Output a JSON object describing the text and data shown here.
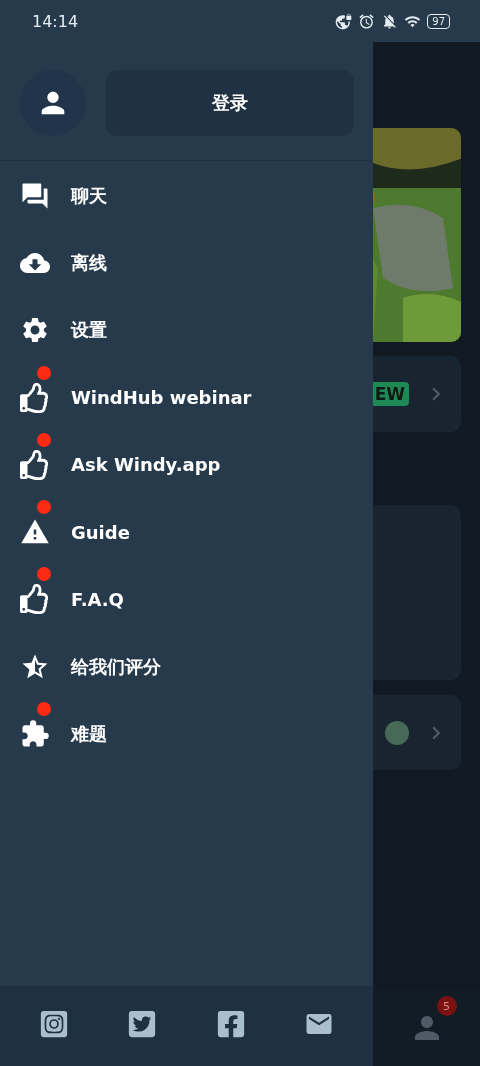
{
  "status_bar": {
    "time": "14:14",
    "battery": "97"
  },
  "drawer": {
    "login_button": "登录",
    "menu": [
      {
        "label": "聊天",
        "kind": "chat",
        "dot": false
      },
      {
        "label": "离线",
        "kind": "cloud",
        "dot": false
      },
      {
        "label": "设置",
        "kind": "gear",
        "dot": false
      },
      {
        "label": "WindHub webinar",
        "kind": "thumb",
        "dot": true
      },
      {
        "label": "Ask Windy.app",
        "kind": "thumb",
        "dot": true
      },
      {
        "label": "Guide",
        "kind": "warning",
        "dot": true
      },
      {
        "label": "F.A.Q",
        "kind": "thumb",
        "dot": true
      },
      {
        "label": "给我们评分",
        "kind": "star",
        "dot": false
      },
      {
        "label": "难题",
        "kind": "puzzle",
        "dot": true
      }
    ]
  },
  "background": {
    "tag": "EW",
    "profile_badge": "5"
  }
}
